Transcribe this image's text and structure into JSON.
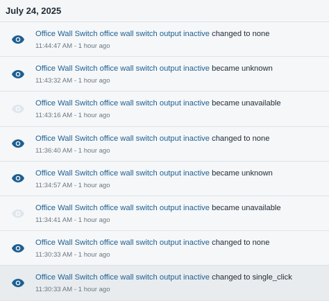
{
  "date_header": "July 24, 2025",
  "colors": {
    "eye_active": "#1e5f91",
    "eye_inactive": "#dfe6ec",
    "link": "#1e5f91",
    "text": "#1f2a33",
    "muted": "#6b7780"
  },
  "entries": [
    {
      "entity": "Office Wall Switch office wall switch output inactive",
      "change": "changed to none",
      "time": "11:44:47 AM",
      "sep": " - ",
      "relative": "1 hour ago",
      "icon": "eye-icon",
      "icon_state": "active"
    },
    {
      "entity": "Office Wall Switch office wall switch output inactive",
      "change": "became unknown",
      "time": "11:43:32 AM",
      "sep": " - ",
      "relative": "1 hour ago",
      "icon": "eye-icon",
      "icon_state": "active"
    },
    {
      "entity": "Office Wall Switch office wall switch output inactive",
      "change": "became unavailable",
      "time": "11:43:16 AM",
      "sep": " - ",
      "relative": "1 hour ago",
      "icon": "eye-icon",
      "icon_state": "inactive"
    },
    {
      "entity": "Office Wall Switch office wall switch output inactive",
      "change": "changed to none",
      "time": "11:36:40 AM",
      "sep": " - ",
      "relative": "1 hour ago",
      "icon": "eye-icon",
      "icon_state": "active"
    },
    {
      "entity": "Office Wall Switch office wall switch output inactive",
      "change": "became unknown",
      "time": "11:34:57 AM",
      "sep": " - ",
      "relative": "1 hour ago",
      "icon": "eye-icon",
      "icon_state": "active"
    },
    {
      "entity": "Office Wall Switch office wall switch output inactive",
      "change": "became unavailable",
      "time": "11:34:41 AM",
      "sep": " - ",
      "relative": "1 hour ago",
      "icon": "eye-icon",
      "icon_state": "inactive"
    },
    {
      "entity": "Office Wall Switch office wall switch output inactive",
      "change": "changed to none",
      "time": "11:30:33 AM",
      "sep": " - ",
      "relative": "1 hour ago",
      "icon": "eye-icon",
      "icon_state": "active"
    },
    {
      "entity": "Office Wall Switch office wall switch output inactive",
      "change": "changed to single_click",
      "time": "11:30:33 AM",
      "sep": " - ",
      "relative": "1 hour ago",
      "icon": "eye-icon",
      "icon_state": "active",
      "highlighted": true
    }
  ]
}
